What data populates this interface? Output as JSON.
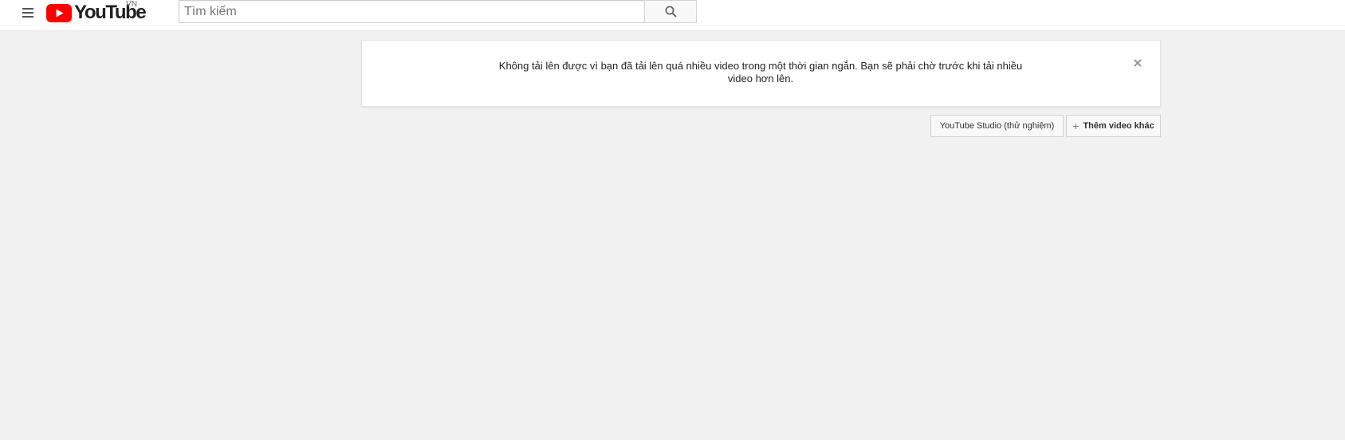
{
  "masthead": {
    "logo_text": "YouTube",
    "country_code": "VN",
    "search": {
      "placeholder": "Tìm kiếm",
      "value": ""
    },
    "icons": {
      "menu": "hamburger-menu-icon",
      "logo": "youtube-play-icon",
      "search": "search-icon"
    }
  },
  "alert": {
    "message": "Không tải lên được vì bạn đã tải lên quá nhiều video trong một thời gian ngắn. Bạn sẽ phải chờ trước khi tải nhiều video hơn lên.",
    "close_icon": "close-icon"
  },
  "actions": {
    "studio_label": "YouTube Studio (thử nghiệm)",
    "add_more_label": "Thêm video khác",
    "add_icon": "plus-icon"
  },
  "colors": {
    "brand_red": "#ff0000",
    "page_background": "#f1f1f1",
    "masthead_background": "#ffffff"
  }
}
